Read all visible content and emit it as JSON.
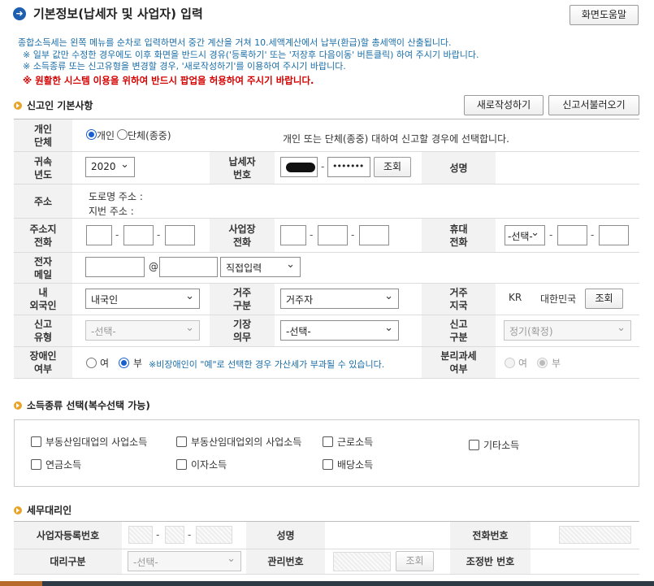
{
  "page": {
    "title": "기본정보(납세자 및 사업자) 입력",
    "help_button": "화면도움말"
  },
  "info": {
    "line1": "종합소득세는 왼쪽 메뉴를 순차로 입력하면서 중간 계산을 거쳐 10.세액계산에서 납부(환급)할 총세액이 산출됩니다.",
    "line2": "※ 일부 값만 수정한 경우에도 이후 화면을 반드시 경유('등록하기' 또는 '저장후 다음이동' 버튼클릭) 하여 주시기 바랍니다.",
    "line3": "※ 소득종류 또는 신고유형을 변경할 경우, '새로작성하기'를 이용하여 주시기 바랍니다.",
    "warning": "※ 원활한 시스템 이용을 위하여 반드시 팝업을 허용하여 주시기 바랍니다."
  },
  "section1": {
    "title": "신고인 기본사항",
    "new_button": "새로작성하기",
    "load_button": "신고서불러오기"
  },
  "form": {
    "individual_label": "개인\n단체",
    "individual_option": "개인",
    "group_option": "단체(종중)",
    "individual_note": "개인 또는 단체(종중) 대하여 신고할 경우에 선택합니다.",
    "year_label": "귀속\n년도",
    "year_value": "2020",
    "taxpayer_id_label": "납세자\n번호",
    "taxpayer_id_masked": "•••••••",
    "lookup_button": "조회",
    "name_label": "성명",
    "address_label": "주소",
    "road_address": "도로명 주소 :",
    "lot_address": "지번 주소 :",
    "home_phone_label": "주소지\n전화",
    "business_phone_label": "사업장\n전화",
    "mobile_label": "휴대\n전화",
    "mobile_select": "-선택-",
    "email_label": "전자\n메일",
    "at": "@",
    "email_domain": "직접입력",
    "nationality_label": "내\n외국인",
    "nationality_value": "내국인",
    "residence_label": "거주\n구분",
    "residence_value": "거주자",
    "residence_country_label": "거주\n지국",
    "country_code": "KR",
    "country_name": "대한민국",
    "country_lookup": "조회",
    "report_type_label": "신고\n유형",
    "report_type_value": "-선택-",
    "bookkeeping_label": "기장\n의무",
    "bookkeeping_value": "-선택-",
    "report_class_label": "신고\n구분",
    "report_class_value": "정기(확정)",
    "disabled_label": "장애인\n여부",
    "yes": "여",
    "no": "부",
    "disabled_note": "※비장애인이 \"예\"로 선택한 경우 가산세가 부과될 수 있습니다.",
    "separate_tax_label": "분리과세\n여부",
    "sep_yes": "여",
    "sep_no": "부"
  },
  "section2": {
    "title": "소득종류 선택(복수선택 가능)",
    "items": [
      "부동산임대업의 사업소득",
      "부동산임대업외의 사업소득",
      "근로소득",
      "기타소득",
      "연금소득",
      "이자소득",
      "배당소득"
    ]
  },
  "section3": {
    "title": "세무대리인",
    "biz_reg_label": "사업자등록번호",
    "name_label": "성명",
    "phone_label": "전화번호",
    "agent_type_label": "대리구분",
    "agent_type_value": "-선택-",
    "manage_no_label": "관리번호",
    "lookup_button": "조회",
    "team_no_label": "조정반 번호"
  }
}
